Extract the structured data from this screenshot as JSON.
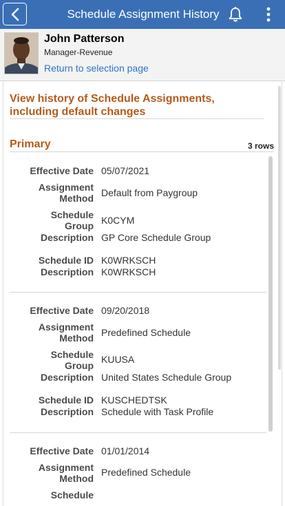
{
  "header": {
    "title": "Schedule Assignment History"
  },
  "profile": {
    "name": "John Patterson",
    "role": "Manager-Revenue",
    "return_link": "Return to selection page"
  },
  "page": {
    "heading": "View history of Schedule Assignments, including default changes",
    "section_title": "Primary",
    "row_count": "3 rows"
  },
  "labels": {
    "effective_date": "Effective Date",
    "assignment_method_1": "Assignment",
    "assignment_method_2": "Method",
    "schedule_group_1": "Schedule",
    "schedule_group_2": "Group",
    "description": "Description",
    "schedule_id": "Schedule ID"
  },
  "rows": [
    {
      "effective_date": "05/07/2021",
      "assignment_method": "Default from Paygroup",
      "schedule_group": "K0CYM",
      "group_description": "GP Core Schedule Group",
      "schedule_id": "K0WRKSCH",
      "schedule_description": "K0WRKSCH"
    },
    {
      "effective_date": "09/20/2018",
      "assignment_method": "Predefined Schedule",
      "schedule_group": "KUUSA",
      "group_description": "United States Schedule Group",
      "schedule_id": "KUSCHEDTSK",
      "schedule_description": "Schedule with Task Profile"
    },
    {
      "effective_date": "01/01/2014",
      "assignment_method": "Predefined Schedule"
    }
  ],
  "icons": {
    "back": "chevron-left-icon",
    "notifications": "bell-icon",
    "menu": "kebab-menu-icon"
  },
  "colors": {
    "header_bg": "#3a6fb6",
    "accent_heading": "#b65a1b",
    "link": "#2d74c4"
  }
}
